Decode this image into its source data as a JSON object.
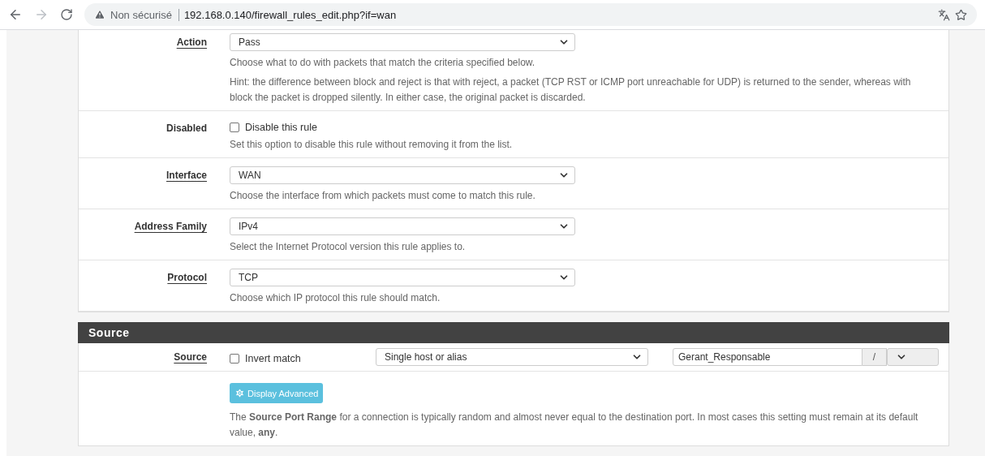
{
  "browser": {
    "security": "Non sécurisé",
    "url": "192.168.0.140/firewall_rules_edit.php?if=wan"
  },
  "rows": [
    {
      "kind": "select",
      "label": "Action",
      "link": true,
      "value": "Pass",
      "help": [
        "Choose what to do with packets that match the criteria specified below.",
        "Hint: the difference between block and reject is that with reject, a packet (TCP RST or ICMP port unreachable for UDP) is returned to the sender, whereas with block the packet is dropped silently. In either case, the original packet is discarded."
      ]
    },
    {
      "kind": "checkbox",
      "label": "Disabled",
      "link": false,
      "checked": false,
      "text": "Disable this rule",
      "help": [
        "Set this option to disable this rule without removing it from the list."
      ]
    },
    {
      "kind": "select",
      "label": "Interface",
      "link": true,
      "value": "WAN",
      "help": [
        "Choose the interface from which packets must come to match this rule."
      ]
    },
    {
      "kind": "select",
      "label": "Address Family",
      "link": true,
      "value": "IPv4",
      "help": [
        "Select the Internet Protocol version this rule applies to."
      ]
    },
    {
      "kind": "select",
      "label": "Protocol",
      "link": true,
      "value": "TCP",
      "help": [
        "Choose which IP protocol this rule should match."
      ]
    }
  ],
  "source": {
    "heading": "Source",
    "label": "Source",
    "invert": {
      "text": "Invert match",
      "checked": false
    },
    "type": "Single host or alias",
    "address": "Gerant_Responsable",
    "separator": "/",
    "advanced_button": "Display Advanced",
    "help": "The **Source Port Range** for a connection is typically random and almost never equal to the destination port. In most cases this setting must remain at its default value, **any**."
  }
}
